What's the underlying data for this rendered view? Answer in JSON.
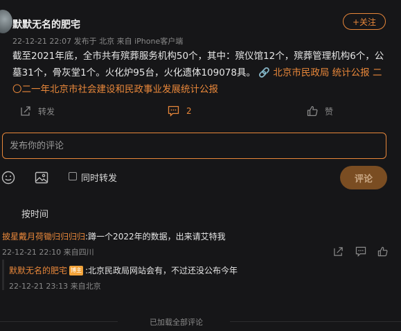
{
  "post": {
    "username": "默默无名的肥宅",
    "meta": "22-12-21 22:07  发布于 北京  来自 iPhone客户端",
    "follow_label": "+关注",
    "text_main": "截至2021年底，全市共有殡葬服务机构50个，其中：殡仪馆12个，殡葬管理机构6个，公墓31个，骨灰堂1个。火化炉95台，火化遗体109078具。",
    "link_source": "北京市民政局 统计公报",
    "link_report": "二〇二一年北京市社会建设和民政事业发展统计公报",
    "repost_label": "转发",
    "comment_count": "2",
    "like_label": "赞"
  },
  "composer": {
    "placeholder": "发布你的评论",
    "also_repost_label": "同时转发",
    "submit_label": "评论"
  },
  "comments": {
    "sort_label": "按时间",
    "c1": {
      "author": "披星戴月荷锄归归归归",
      "text": ":蹲一个2022年的数据，出来请艾特我",
      "meta": "22-12-21 22:10  来自四川"
    },
    "r1": {
      "author": "默默无名的肥宅",
      "badge": "博主",
      "text": ":北京民政局网站会有，不过还没公布今年",
      "meta": "22-12-21 23:13  来自北京"
    },
    "footer": "已加载全部评论"
  },
  "colors": {
    "accent": "#e8873a",
    "background": "#161618"
  }
}
